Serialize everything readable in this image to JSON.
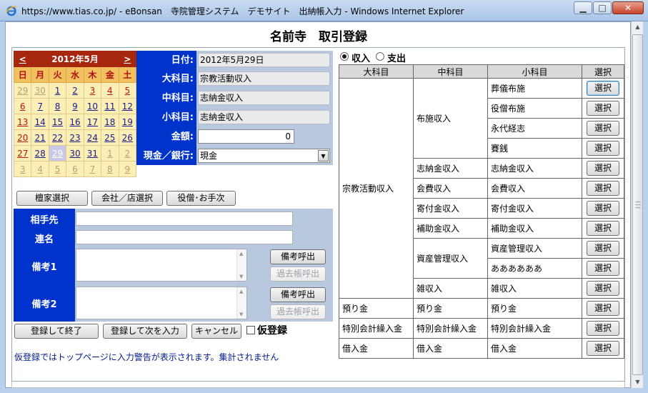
{
  "window": {
    "title": "https://www.tias.co.jp/ - eBonsan　寺院管理システム　デモサイト　出納帳入力 - Windows Internet Explorer",
    "minimize": "▁",
    "maximize": "□",
    "close": "✕"
  },
  "page": {
    "title": "名前寺　取引登録"
  },
  "calendar": {
    "prev": "<",
    "next": ">",
    "month_label": "2012年5月",
    "weekdays": [
      "日",
      "月",
      "火",
      "水",
      "木",
      "金",
      "土"
    ],
    "weeks": [
      [
        "29",
        "30",
        "1",
        "2",
        "3",
        "4",
        "5"
      ],
      [
        "6",
        "7",
        "8",
        "9",
        "10",
        "11",
        "12"
      ],
      [
        "13",
        "14",
        "15",
        "16",
        "17",
        "18",
        "19"
      ],
      [
        "20",
        "21",
        "22",
        "23",
        "24",
        "25",
        "26"
      ],
      [
        "27",
        "28",
        "29",
        "30",
        "31",
        "1",
        "2"
      ],
      [
        "3",
        "4",
        "5",
        "6",
        "7",
        "8",
        "9"
      ]
    ],
    "selected_day": "29"
  },
  "form": {
    "date": {
      "label": "日付:",
      "value": "2012年5月29日"
    },
    "major": {
      "label": "大科目:",
      "value": "宗教活動収入"
    },
    "middle": {
      "label": "中科目:",
      "value": "志納金収入"
    },
    "minor": {
      "label": "小科目:",
      "value": "志納金収入"
    },
    "amount": {
      "label": "金額:",
      "value": "0"
    },
    "cash": {
      "label": "現金／銀行:",
      "value": "現金",
      "arrow": "▼"
    }
  },
  "select_buttons": {
    "danka": "檀家選択",
    "company": "会社／店選択",
    "priest": "役僧･お手次"
  },
  "details": {
    "partner_label": "相手先",
    "partner_value": "",
    "cosigner_label": "連名",
    "cosigner_value": "",
    "memo1_label": "備考1",
    "memo1_value": "",
    "memo2_label": "備考2",
    "memo2_value": "",
    "memo_call": "備考呼出",
    "past_call": "過去帳呼出"
  },
  "actions": {
    "register_finish": "登録して終了",
    "register_next": "登録して次を入力",
    "cancel": "キャンセル",
    "provisional_label": "仮登録"
  },
  "note": "仮登録ではトップページに入力警告が表示されます。集計されません",
  "type_toggle": {
    "income": "収入",
    "expense": "支出",
    "selected": "income"
  },
  "accounts": {
    "headers": [
      "大科目",
      "中科目",
      "小科目",
      "選択"
    ],
    "select_label": "選択",
    "groups": [
      {
        "major": "宗教活動収入",
        "middles": [
          {
            "name": "布施収入",
            "minors": [
              "葬儀布施",
              "役僧布施",
              "永代経志",
              "賽銭"
            ]
          },
          {
            "name": "志納金収入",
            "minors": [
              "志納金収入"
            ]
          },
          {
            "name": "会費収入",
            "minors": [
              "会費収入"
            ]
          },
          {
            "name": "寄付金収入",
            "minors": [
              "寄付金収入"
            ]
          },
          {
            "name": "補助金収入",
            "minors": [
              "補助金収入"
            ]
          },
          {
            "name": "資産管理収入",
            "minors": [
              "資産管理収入",
              "ああああああ"
            ]
          },
          {
            "name": "雑収入",
            "minors": [
              "雑収入"
            ]
          }
        ]
      },
      {
        "major": "預り金",
        "middles": [
          {
            "name": "預り金",
            "minors": [
              "預り金"
            ]
          }
        ]
      },
      {
        "major": "特別会計繰入金",
        "middles": [
          {
            "name": "特別会計繰入金",
            "minors": [
              "特別会計繰入金"
            ]
          }
        ]
      },
      {
        "major": "借入金",
        "middles": [
          {
            "name": "借入金",
            "minors": [
              "借入金"
            ]
          }
        ]
      }
    ]
  }
}
